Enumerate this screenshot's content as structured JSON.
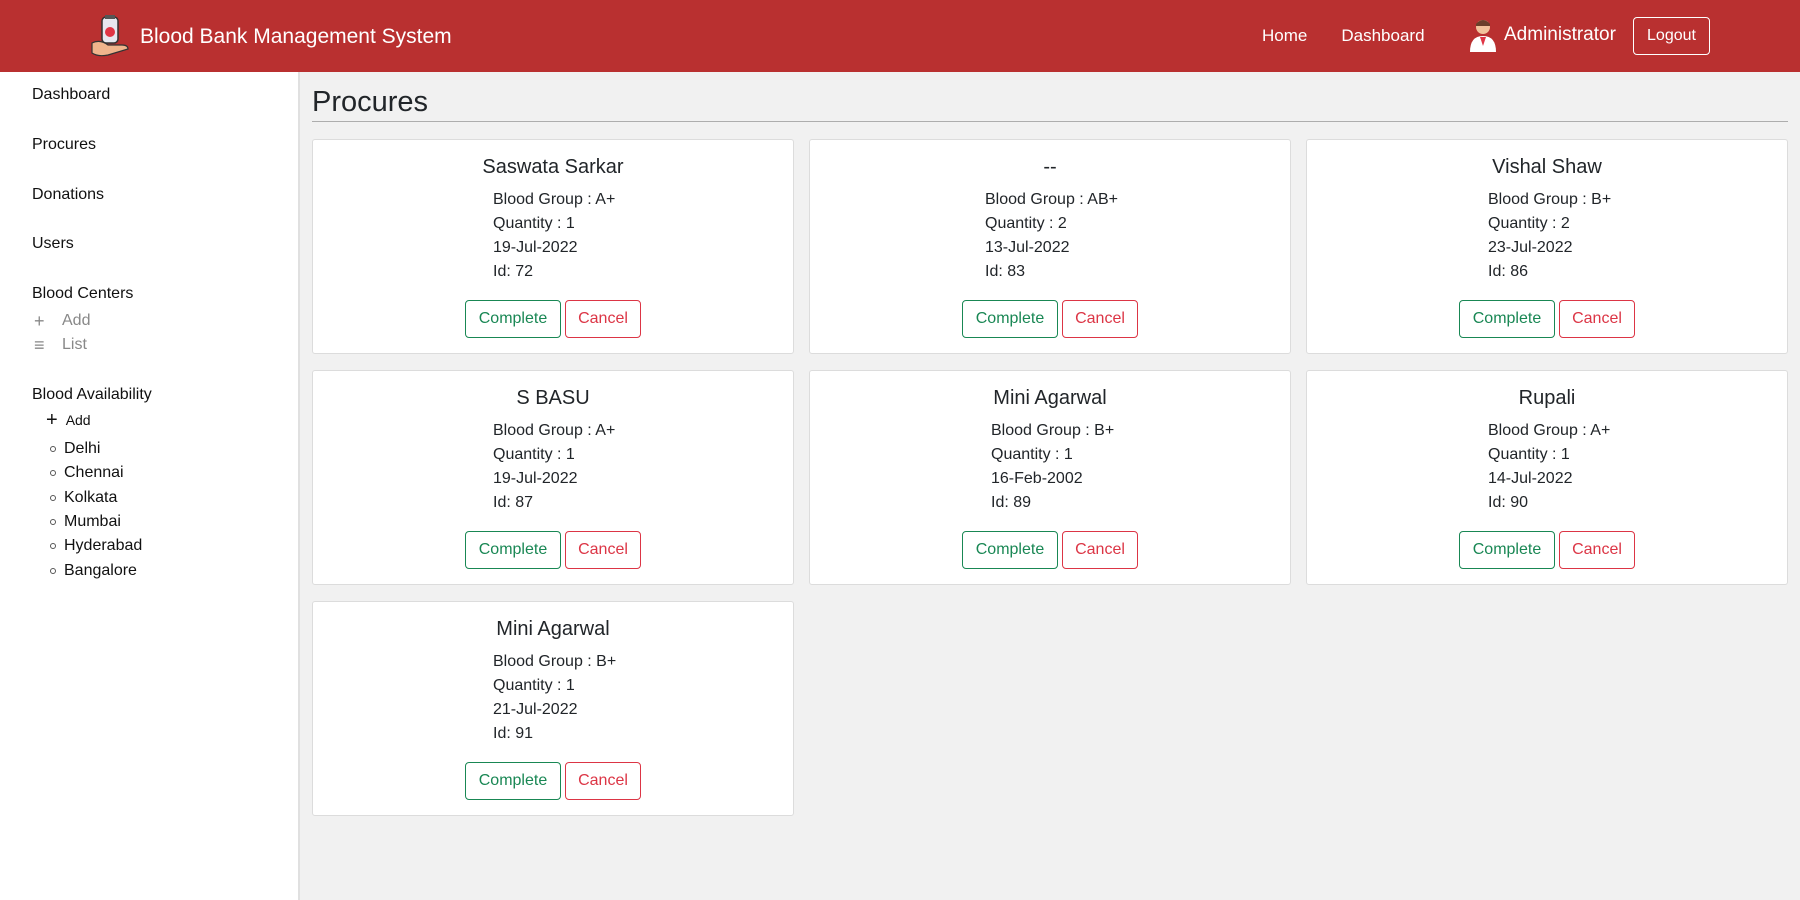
{
  "header": {
    "title": "Blood Bank Management System",
    "nav": [
      "Home",
      "Dashboard"
    ],
    "user": "Administrator",
    "logout": "Logout",
    "bg_color": "#b93030"
  },
  "sidebar": {
    "links": [
      "Dashboard",
      "Procures",
      "Donations",
      "Users"
    ],
    "blood_centers": {
      "heading": "Blood Centers",
      "add": "Add",
      "list": "List"
    },
    "blood_availability": {
      "heading": "Blood Availability",
      "add": "Add",
      "cities": [
        "Delhi",
        "Chennai",
        "Kolkata",
        "Mumbai",
        "Hyderabad",
        "Bangalore"
      ]
    }
  },
  "main": {
    "title": "Procures",
    "cards": [
      {
        "name": "Saswata Sarkar",
        "group": "Blood Group : A+",
        "quantity": "Quantity : 1",
        "date": "19-Jul-2022",
        "id": "Id: 72"
      },
      {
        "name": "--",
        "group": "Blood Group : AB+",
        "quantity": "Quantity : 2",
        "date": "13-Jul-2022",
        "id": "Id: 83"
      },
      {
        "name": "Vishal Shaw",
        "group": "Blood Group : B+",
        "quantity": "Quantity : 2",
        "date": "23-Jul-2022",
        "id": "Id: 86"
      },
      {
        "name": "S BASU",
        "group": "Blood Group : A+",
        "quantity": "Quantity : 1",
        "date": "19-Jul-2022",
        "id": "Id: 87"
      },
      {
        "name": "Mini Agarwal",
        "group": "Blood Group : B+",
        "quantity": "Quantity : 1",
        "date": "16-Feb-2002",
        "id": "Id: 89"
      },
      {
        "name": "Rupali",
        "group": "Blood Group : A+",
        "quantity": "Quantity : 1",
        "date": "14-Jul-2022",
        "id": "Id: 90"
      },
      {
        "name": "Mini Agarwal",
        "group": "Blood Group : B+",
        "quantity": "Quantity : 1",
        "date": "21-Jul-2022",
        "id": "Id: 91"
      }
    ],
    "complete_label": "Complete",
    "cancel_label": "Cancel"
  }
}
